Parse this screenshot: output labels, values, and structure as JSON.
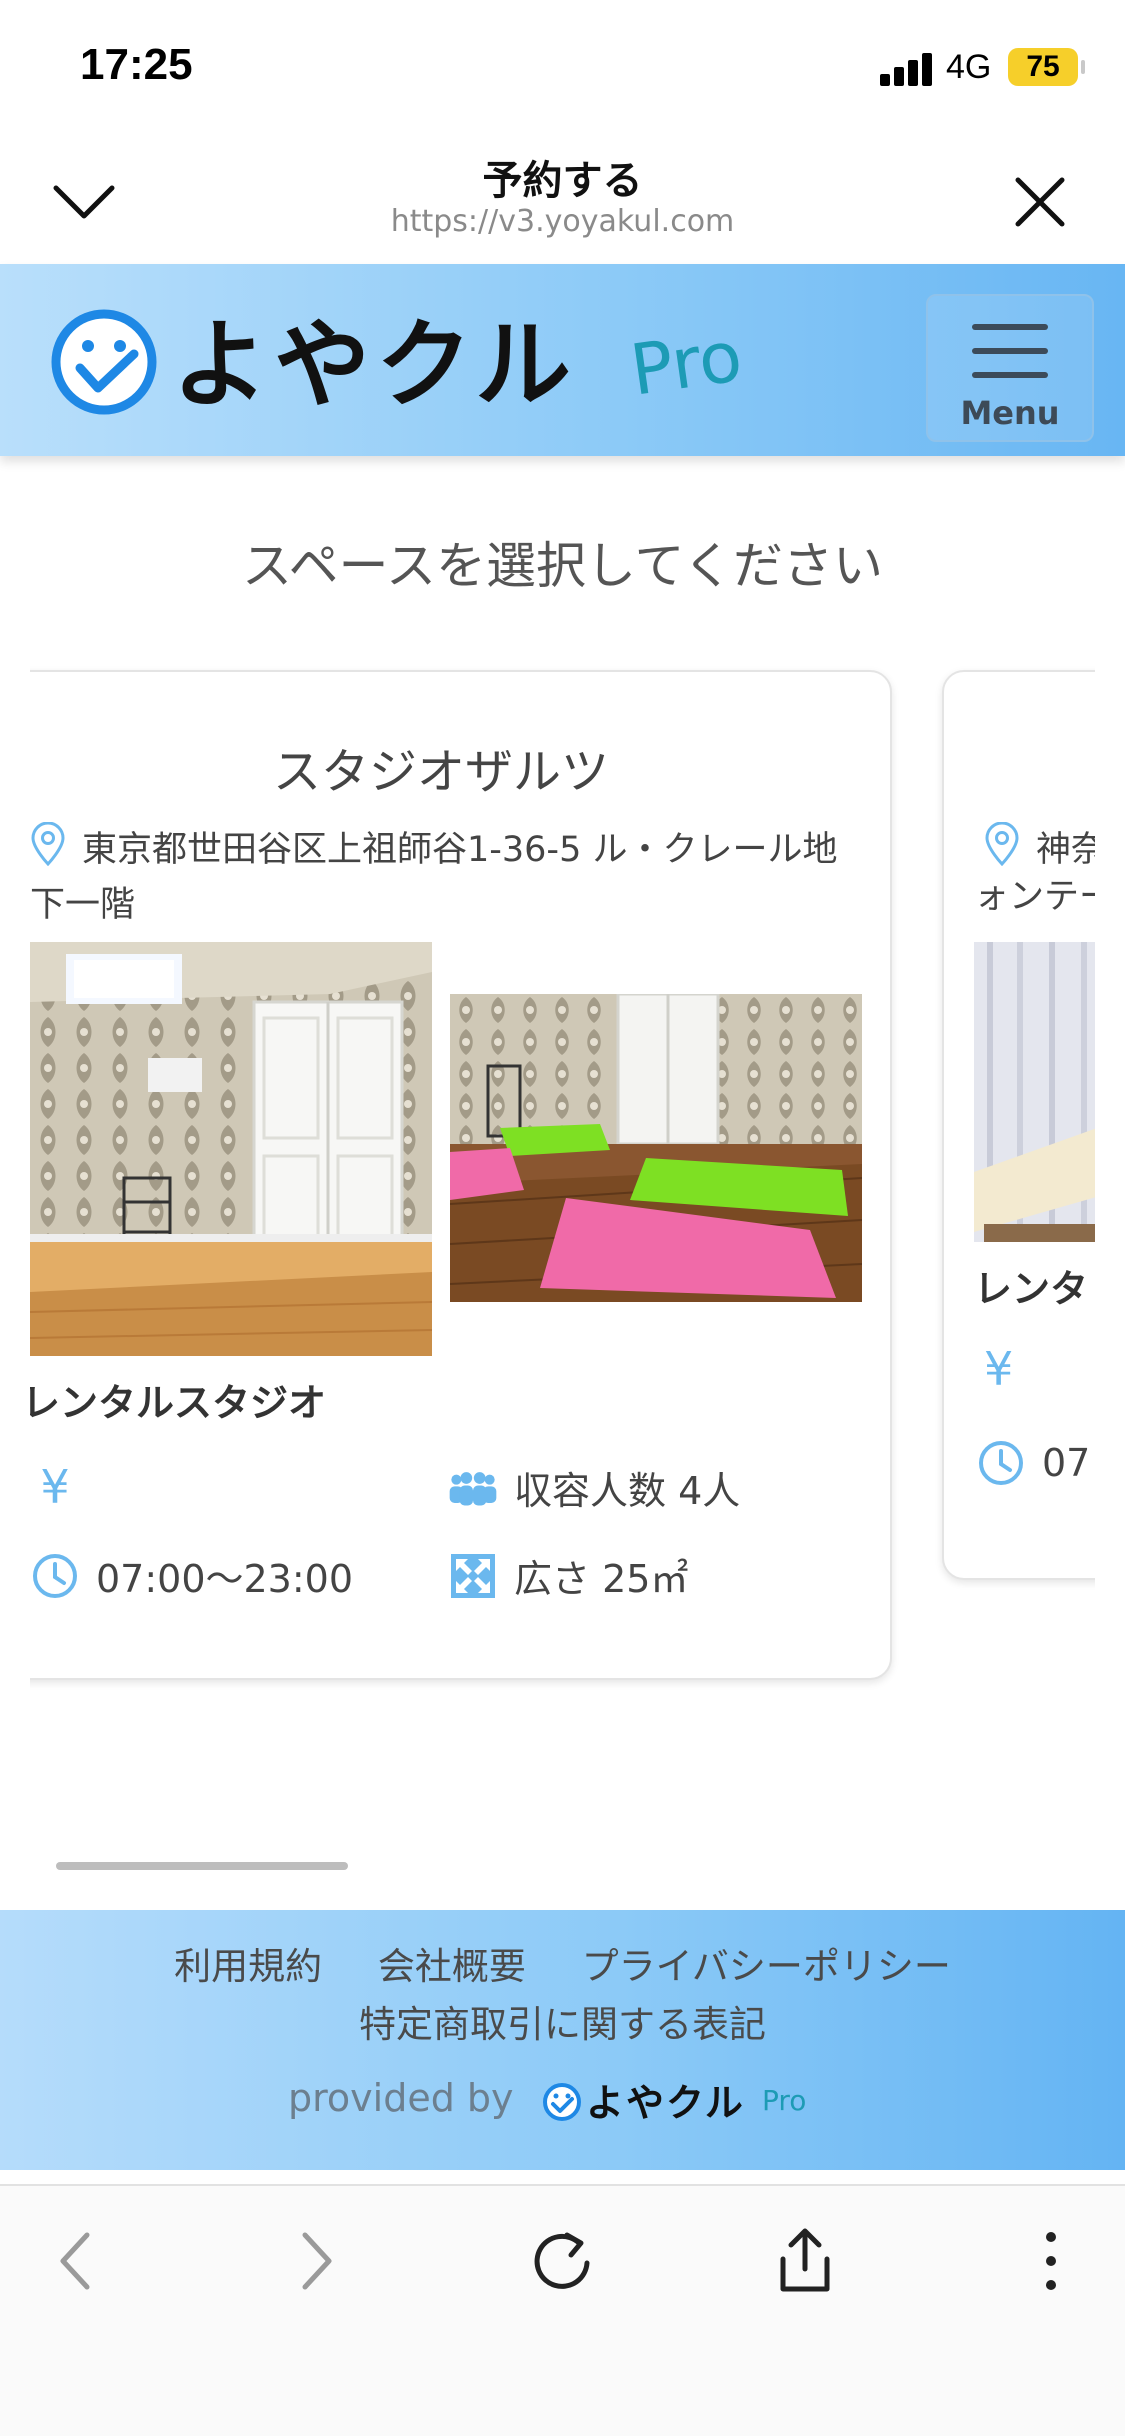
{
  "status_bar": {
    "time": "17:25",
    "network": "4G",
    "battery": "75"
  },
  "browser_header": {
    "title": "予約する",
    "url": "https://v3.yoyakul.com"
  },
  "site_header": {
    "logo_text": "よやクル",
    "logo_sub": "Pro",
    "menu_label": "Menu"
  },
  "main": {
    "heading": "スペースを選択してください",
    "cards": [
      {
        "title": "スタジオザルツ",
        "address": "東京都世田谷区上祖師谷1-36-5 ル・クレール地下一階",
        "space_type": "レンタルスタジオ",
        "price_symbol": "¥",
        "capacity": "収容人数 4人",
        "hours": "07:00〜23:00",
        "area": "広さ 25㎡"
      },
      {
        "address_partial": "神奈",
        "address_line2_partial": "ォンテー",
        "space_type_partial": "レンタ",
        "price_symbol": "¥",
        "hours_partial": "07"
      }
    ]
  },
  "footer": {
    "links": [
      "利用規約",
      "会社概要",
      "プライバシーポリシー"
    ],
    "link_commerce": "特定商取引に関する表記",
    "provided_by": "provided by",
    "logo_text": "よやクル",
    "logo_sub": "Pro"
  },
  "icons": {
    "header_left": "chevron-down-icon",
    "header_right": "close-icon",
    "toolbar": [
      "back-icon",
      "forward-icon",
      "reload-icon",
      "share-icon",
      "more-icon"
    ]
  },
  "colors": {
    "brand_blue": "#1e88e5",
    "header_gradient_end": "#68b6f3",
    "icon_blue": "#6bb8ee"
  }
}
